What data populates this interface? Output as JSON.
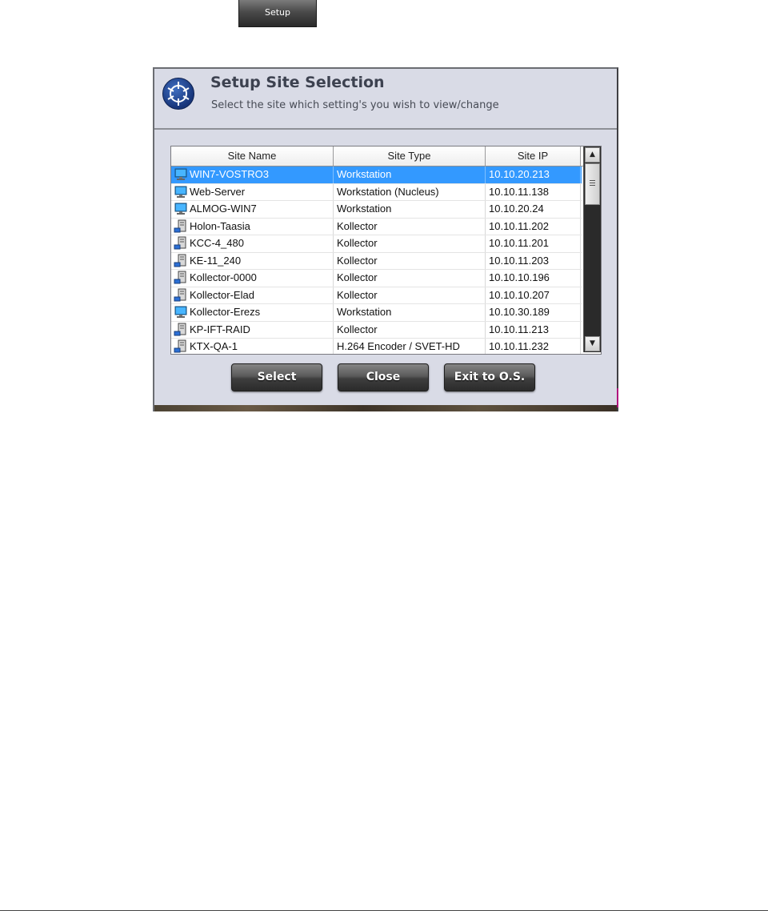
{
  "top_button": {
    "label": "Setup"
  },
  "dialog": {
    "title": "Setup Site Selection",
    "subtitle": "Select the site which setting's you wish to view/change",
    "columns": [
      "Site Name",
      "Site Type",
      "Site IP"
    ],
    "rows": [
      {
        "name": "WIN7-VOSTRO3",
        "type": "Workstation",
        "ip": "10.10.20.213",
        "icon": "monitor-icon",
        "selected": true
      },
      {
        "name": "Web-Server",
        "type": "Workstation (Nucleus)",
        "ip": "10.10.11.138",
        "icon": "monitor-icon"
      },
      {
        "name": "ALMOG-WIN7",
        "type": "Workstation",
        "ip": "10.10.20.24",
        "icon": "monitor-icon"
      },
      {
        "name": "Holon-Taasia",
        "type": "Kollector",
        "ip": "10.10.11.202",
        "icon": "server-icon"
      },
      {
        "name": "KCC-4_480",
        "type": "Kollector",
        "ip": "10.10.11.201",
        "icon": "server-icon"
      },
      {
        "name": "KE-11_240",
        "type": "Kollector",
        "ip": "10.10.11.203",
        "icon": "server-icon"
      },
      {
        "name": "Kollector-0000",
        "type": "Kollector",
        "ip": "10.10.10.196",
        "icon": "server-icon"
      },
      {
        "name": "Kollector-Elad",
        "type": "Kollector",
        "ip": "10.10.10.207",
        "icon": "server-icon"
      },
      {
        "name": "Kollector-Erezs",
        "type": "Workstation",
        "ip": "10.10.30.189",
        "icon": "monitor-icon"
      },
      {
        "name": "KP-IFT-RAID",
        "type": "Kollector",
        "ip": "10.10.11.213",
        "icon": "server-icon"
      },
      {
        "name": "KTX-QA-1",
        "type": "H.264 Encoder / SVET-HD",
        "ip": "10.10.11.232",
        "icon": "server-icon"
      }
    ],
    "buttons": {
      "select": "Select",
      "close": "Close",
      "exit": "Exit to O.S."
    }
  },
  "colors": {
    "selection": "#3399ff",
    "dialog_bg": "#d9dbe6",
    "button_dark": "#3e3e3e"
  }
}
